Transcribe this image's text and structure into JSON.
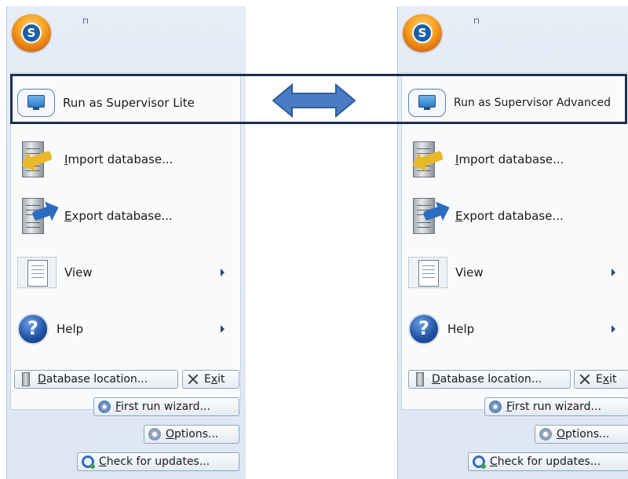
{
  "left_panel": {
    "qat_glyph": "⊓",
    "menu": {
      "run_label": "Run as Supervisor Lite",
      "import_prefix": "I",
      "import_rest": "mport database...",
      "export_prefix": "E",
      "export_rest": "xport database...",
      "view_label": "View",
      "help_label": "Help"
    },
    "buttons": {
      "db_prefix": "D",
      "db_rest": "atabase location...",
      "exit_pre": "E",
      "exit_u": "x",
      "exit_post": "it",
      "wizard_prefix": "F",
      "wizard_rest": "irst run wizard...",
      "options_prefix": "O",
      "options_rest": "ptions...",
      "updates_prefix": "C",
      "updates_rest": "heck for updates..."
    }
  },
  "right_panel": {
    "qat_glyph": "⊓",
    "menu": {
      "run_label": "Run as Supervisor Advanced",
      "import_prefix": "I",
      "import_rest": "mport database...",
      "export_prefix": "E",
      "export_rest": "xport database...",
      "view_label": "View",
      "help_label": "Help"
    },
    "buttons": {
      "db_prefix": "D",
      "db_rest": "atabase location...",
      "exit_pre": "E",
      "exit_u": "x",
      "exit_post": "it",
      "wizard_prefix": "F",
      "wizard_rest": "irst run wizard...",
      "options_prefix": "O",
      "options_rest": "ptions...",
      "updates_prefix": "C",
      "updates_rest": "heck for updates..."
    }
  },
  "icons": {
    "app_orb": "app-orb-icon",
    "run": "monitor-icon",
    "import": "server-import-icon",
    "export": "server-export-icon",
    "view": "page-icon",
    "help": "help-question-icon",
    "submenu": "chevron-right-icon",
    "db_location": "database-icon",
    "exit": "close-icon",
    "wizard": "wizard-gear-icon",
    "options": "options-gear-icon",
    "updates": "update-magnifier-icon"
  },
  "colors": {
    "highlight_border": "#1e2c4e",
    "comparison_arrow": "#4a7cc4",
    "panel_background": "#dde7f3"
  },
  "help_glyph": "?"
}
